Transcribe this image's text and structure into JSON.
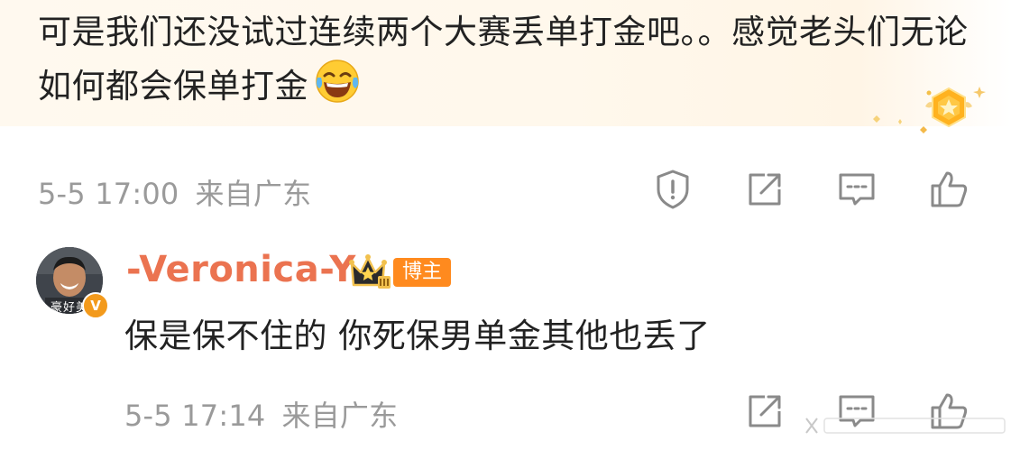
{
  "comment": {
    "text": "可是我们还没试过连续两个大赛丢单打金吧。。感觉老头们无论如何都会保单打金",
    "emoji": "laughing-tears-emoji",
    "time": "5-5 17:00",
    "location": "来自广东",
    "actions": [
      "report-icon",
      "share-icon",
      "comment-icon",
      "like-icon"
    ]
  },
  "reply": {
    "username": "-Veronica-Y",
    "role_badge": "博主",
    "avatar_caption": "豪好美",
    "verified_mark": "V",
    "text": "保是保不住的 你死保男单金其他也丢了",
    "time": "5-5 17:14",
    "location": "来自广东",
    "actions": [
      "share-icon",
      "comment-icon",
      "like-icon"
    ]
  },
  "colors": {
    "username": "#eb7350",
    "meta": "#9a9a9a",
    "badge": "#ff8a1e",
    "card_bg": "#fff8ec"
  }
}
